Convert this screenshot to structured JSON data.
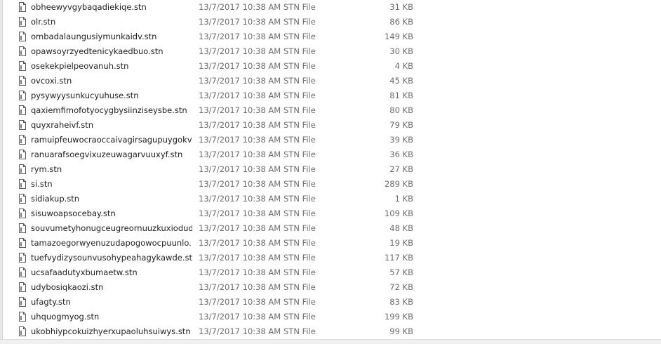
{
  "files": [
    {
      "name": "obheewyvgybaqadiekiqe.stn",
      "date": "13/7/2017 10:38 AM",
      "type": "STN File",
      "size": "31 KB"
    },
    {
      "name": "olr.stn",
      "date": "13/7/2017 10:38 AM",
      "type": "STN File",
      "size": "86 KB"
    },
    {
      "name": "ombadalaungusiymunkaidv.stn",
      "date": "13/7/2017 10:38 AM",
      "type": "STN File",
      "size": "149 KB"
    },
    {
      "name": "opawsoyrzyedtenicykaedbuo.stn",
      "date": "13/7/2017 10:38 AM",
      "type": "STN File",
      "size": "30 KB"
    },
    {
      "name": "osekekpielpeovanuh.stn",
      "date": "13/7/2017 10:38 AM",
      "type": "STN File",
      "size": "4 KB"
    },
    {
      "name": "ovcoxi.stn",
      "date": "13/7/2017 10:38 AM",
      "type": "STN File",
      "size": "45 KB"
    },
    {
      "name": "pysywyysunkucyuhuse.stn",
      "date": "13/7/2017 10:38 AM",
      "type": "STN File",
      "size": "81 KB"
    },
    {
      "name": "qaxiemfimofotyocygbysiinziseysbe.stn",
      "date": "13/7/2017 10:38 AM",
      "type": "STN File",
      "size": "80 KB"
    },
    {
      "name": "quyxraheivf.stn",
      "date": "13/7/2017 10:38 AM",
      "type": "STN File",
      "size": "79 KB"
    },
    {
      "name": "ramuipfeuwocraoccaivagirsagupuygokv...",
      "date": "13/7/2017 10:38 AM",
      "type": "STN File",
      "size": "39 KB"
    },
    {
      "name": "ranuarafsoegvixuzeuwagarvuuxyf.stn",
      "date": "13/7/2017 10:38 AM",
      "type": "STN File",
      "size": "36 KB"
    },
    {
      "name": "rym.stn",
      "date": "13/7/2017 10:38 AM",
      "type": "STN File",
      "size": "27 KB"
    },
    {
      "name": "si.stn",
      "date": "13/7/2017 10:38 AM",
      "type": "STN File",
      "size": "289 KB"
    },
    {
      "name": "sidiakup.stn",
      "date": "13/7/2017 10:38 AM",
      "type": "STN File",
      "size": "1 KB"
    },
    {
      "name": "sisuwoapsocebay.stn",
      "date": "13/7/2017 10:38 AM",
      "type": "STN File",
      "size": "109 KB"
    },
    {
      "name": "souvumetyhonugceugreornuuzkuxiodud...",
      "date": "13/7/2017 10:38 AM",
      "type": "STN File",
      "size": "48 KB"
    },
    {
      "name": "tamazoegorwyenuzudapogowocpuunlo...",
      "date": "13/7/2017 10:38 AM",
      "type": "STN File",
      "size": "19 KB"
    },
    {
      "name": "tuefvydizysounvusohypeahagykawde.stn",
      "date": "13/7/2017 10:38 AM",
      "type": "STN File",
      "size": "117 KB"
    },
    {
      "name": "ucsafaadutyxbumaetw.stn",
      "date": "13/7/2017 10:38 AM",
      "type": "STN File",
      "size": "57 KB"
    },
    {
      "name": "udybosiqkaozi.stn",
      "date": "13/7/2017 10:38 AM",
      "type": "STN File",
      "size": "72 KB"
    },
    {
      "name": "ufagty.stn",
      "date": "13/7/2017 10:38 AM",
      "type": "STN File",
      "size": "83 KB"
    },
    {
      "name": "uhquogmyog.stn",
      "date": "13/7/2017 10:38 AM",
      "type": "STN File",
      "size": "199 KB"
    },
    {
      "name": "ukobhiypcokuizhyerxupaoluhsuiwys.stn",
      "date": "13/7/2017 10:38 AM",
      "type": "STN File",
      "size": "99 KB"
    }
  ],
  "icon": "generic-file-icon"
}
